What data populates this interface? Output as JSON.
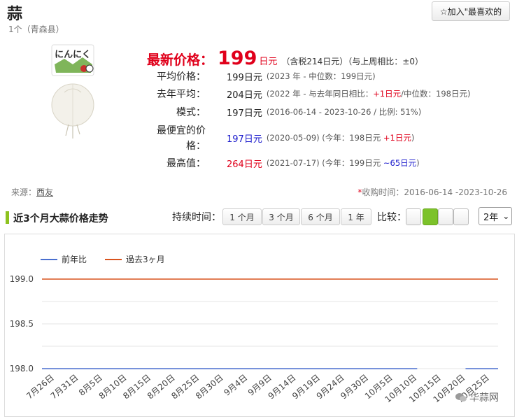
{
  "header": {
    "title": "蒜",
    "subtitle": "1个（青森县）",
    "favorite_label": "☆加入\"最喜欢的"
  },
  "product_image_text": "にんにく",
  "price": {
    "latest_label": "最新价格：",
    "latest_value": "199",
    "latest_unit": "日元",
    "latest_note": "（含税214日元）（与上周相比：±0）"
  },
  "rows": {
    "avg": {
      "label": "平均价格：",
      "value": "199日元",
      "note": "(2023 年 - 中位数：199日元)"
    },
    "last_year": {
      "label": "去年平均：",
      "value": "204日元",
      "note_pre": "(2022 年 - 与去年同日相比：",
      "diff": "+1日元",
      "note_post": "/中位数：198日元)"
    },
    "mode": {
      "label": "模式：",
      "value": "197日元",
      "note": "(2016-06-14 - 2023-10-26 / 比例: 51%)"
    },
    "cheapest": {
      "label_line1": "最便宜的价",
      "label_line2": "格：",
      "value": "197日元",
      "note_pre": "(2020-05-09) (今年：198日元 ",
      "diff": "+1日元",
      "note_post": ")"
    },
    "highest": {
      "label": "最高值：",
      "value": "264日元",
      "note_pre": "(2021-07-17) (今年：199日元 ",
      "diff": "~65日元",
      "note_post": ")"
    }
  },
  "source": {
    "label": "来源：",
    "link": "西友"
  },
  "collection": {
    "star": "*",
    "text": "收购时间：2016-06-14 -2023-10-26"
  },
  "section": {
    "title": "近3个月大蒜价格走势"
  },
  "duration": {
    "label": "持续时间：",
    "options": [
      "1 个月",
      "3 个月",
      "6 个月",
      "1 年"
    ]
  },
  "compare": {
    "label": "比较："
  },
  "year_select": {
    "value": "2年"
  },
  "watermark": "华蒜网",
  "colors": {
    "accent_red": "#e0001b",
    "green": "#7cc22a",
    "series_blue": "#4a6fcf",
    "series_orange": "#d9541e"
  },
  "chart_data": {
    "type": "line",
    "x": [
      "7月26日",
      "7月31日",
      "8月5日",
      "8月10日",
      "8月15日",
      "8月20日",
      "8月25日",
      "8月30日",
      "9月4日",
      "9月9日",
      "9月14日",
      "9月19日",
      "9月24日",
      "9月30日",
      "10月5日",
      "10月10日",
      "10月15日",
      "10月20日",
      "10月25日"
    ],
    "series": [
      {
        "name": "前年比",
        "color": "#4a6fcf",
        "values": [
          198,
          198,
          198,
          198,
          198,
          198,
          198,
          198,
          198,
          198,
          198,
          198,
          198,
          198,
          198,
          198,
          null,
          198,
          198
        ]
      },
      {
        "name": "過去3ヶ月",
        "color": "#d9541e",
        "values": [
          199,
          199,
          199,
          199,
          199,
          199,
          199,
          199,
          199,
          199,
          199,
          199,
          199,
          199,
          199,
          199,
          199,
          199,
          199
        ]
      }
    ],
    "yticks": [
      "199.0",
      "198.5",
      "198.0"
    ],
    "ylim": [
      198,
      199
    ],
    "grid": true,
    "legend": "top-left"
  }
}
